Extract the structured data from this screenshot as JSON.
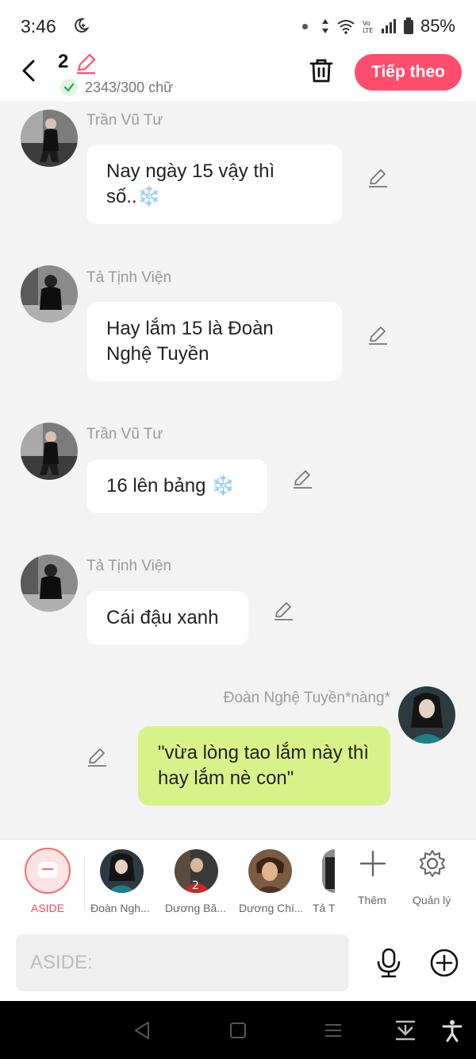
{
  "status_bar": {
    "time": "3:46",
    "battery": "85%",
    "icons": [
      "moon-icon",
      "dot-icon",
      "data-arrows-icon",
      "wifi-icon",
      "volte-icon",
      "signal-icon",
      "battery-icon"
    ]
  },
  "header": {
    "episode_number": "2",
    "word_count": "2343/300 chữ",
    "next_label": "Tiếp theo",
    "accent_color": "#ff4d6d"
  },
  "messages": [
    {
      "sender": "Trần Vũ Tư",
      "text": "Nay ngày 15 vậy thì số..❄️",
      "mine": false
    },
    {
      "sender": "Tả Tịnh Viện",
      "text": "Hay lắm 15 là Đoàn Nghệ Tuyền",
      "mine": false
    },
    {
      "sender": "Trần Vũ Tư",
      "text": "16 lên bảng ❄️",
      "mine": false
    },
    {
      "sender": "Tả Tịnh Viện",
      "text": "Cái đậu xanh",
      "mine": false
    },
    {
      "sender": "Đoàn Nghệ Tuyền*nàng*",
      "text": "\"vừa lòng tao lắm này thì hay lắm nè con\"",
      "mine": true
    }
  ],
  "tray": {
    "aside_label": "ASIDE",
    "characters": [
      "Đoàn Ngh...",
      "Dương Bă...",
      "Dương Chí...",
      "Tả T"
    ],
    "add_label": "Thêm",
    "manage_label": "Quản lý"
  },
  "input": {
    "placeholder": "ASIDE:"
  },
  "colors": {
    "my_bubble": "#d8f28a",
    "other_bubble": "#ffffff",
    "aside_accent": "#ee4a5a"
  }
}
